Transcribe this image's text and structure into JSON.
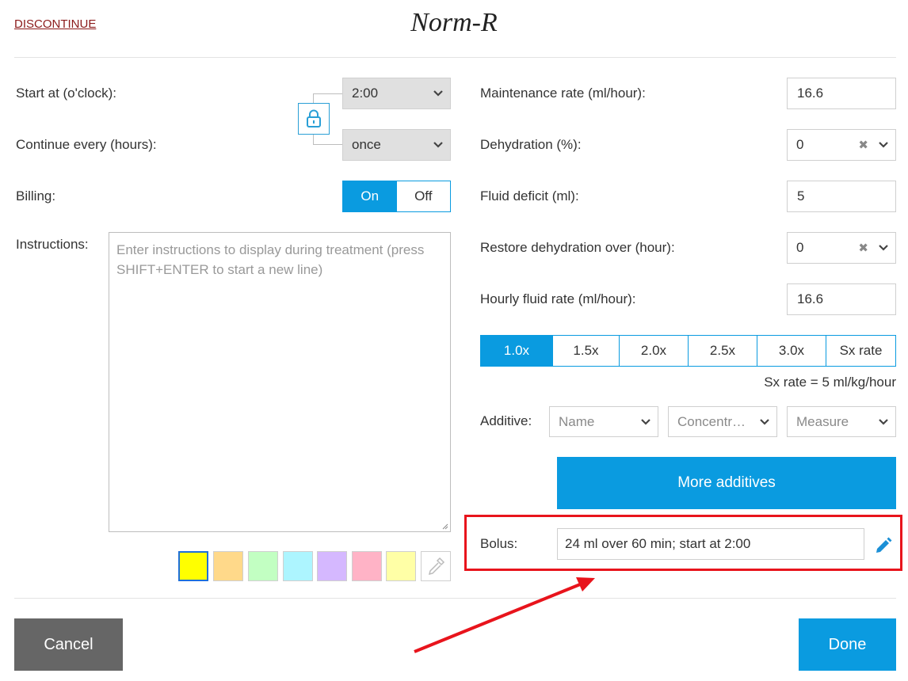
{
  "header": {
    "discontinue_label": "DISCONTINUE",
    "title": "Norm-R"
  },
  "left": {
    "start_label": "Start at (o'clock):",
    "start_value": "2:00",
    "continue_label": "Continue every (hours):",
    "continue_value": "once",
    "billing_label": "Billing:",
    "billing_on": "On",
    "billing_off": "Off",
    "billing_selected": "On",
    "instructions_label": "Instructions:",
    "instructions_placeholder": "Enter instructions to display during treatment (press SHIFT+ENTER to start a new line)",
    "swatches": [
      {
        "color": "#ffff00",
        "selected": true
      },
      {
        "color": "#ffd98a",
        "selected": false
      },
      {
        "color": "#c2ffc2",
        "selected": false
      },
      {
        "color": "#adf5ff",
        "selected": false
      },
      {
        "color": "#d5b8ff",
        "selected": false
      },
      {
        "color": "#ffb3c6",
        "selected": false
      },
      {
        "color": "#ffffa6",
        "selected": false
      }
    ],
    "lock_icon": "lock-icon",
    "eyedropper_icon": "eyedropper-icon"
  },
  "right": {
    "maintenance_label": "Maintenance rate (ml/hour):",
    "maintenance_value": "16.6",
    "dehydration_label": "Dehydration (%):",
    "dehydration_value": "0",
    "fluid_deficit_label": "Fluid deficit (ml):",
    "fluid_deficit_value": "5",
    "restore_label": "Restore dehydration over (hour):",
    "restore_value": "0",
    "hourly_label": "Hourly fluid rate (ml/hour):",
    "hourly_value": "16.6",
    "rate_options": [
      "1.0x",
      "1.5x",
      "2.0x",
      "2.5x",
      "3.0x",
      "Sx rate"
    ],
    "rate_selected": "1.0x",
    "sx_rate_text": "Sx rate = 5 ml/kg/hour",
    "additive_label": "Additive:",
    "additive_name_placeholder": "Name",
    "additive_concentration_placeholder": "Concentr…",
    "additive_measure_placeholder": "Measure",
    "more_additives_label": "More additives",
    "bolus_label": "Bolus:",
    "bolus_value": "24 ml over 60 min; start at 2:00",
    "edit_icon": "pencil-icon"
  },
  "footer": {
    "cancel_label": "Cancel",
    "done_label": "Done"
  },
  "colors": {
    "accent": "#0a9be0",
    "highlight": "#e8141c",
    "cancel": "#666666"
  }
}
